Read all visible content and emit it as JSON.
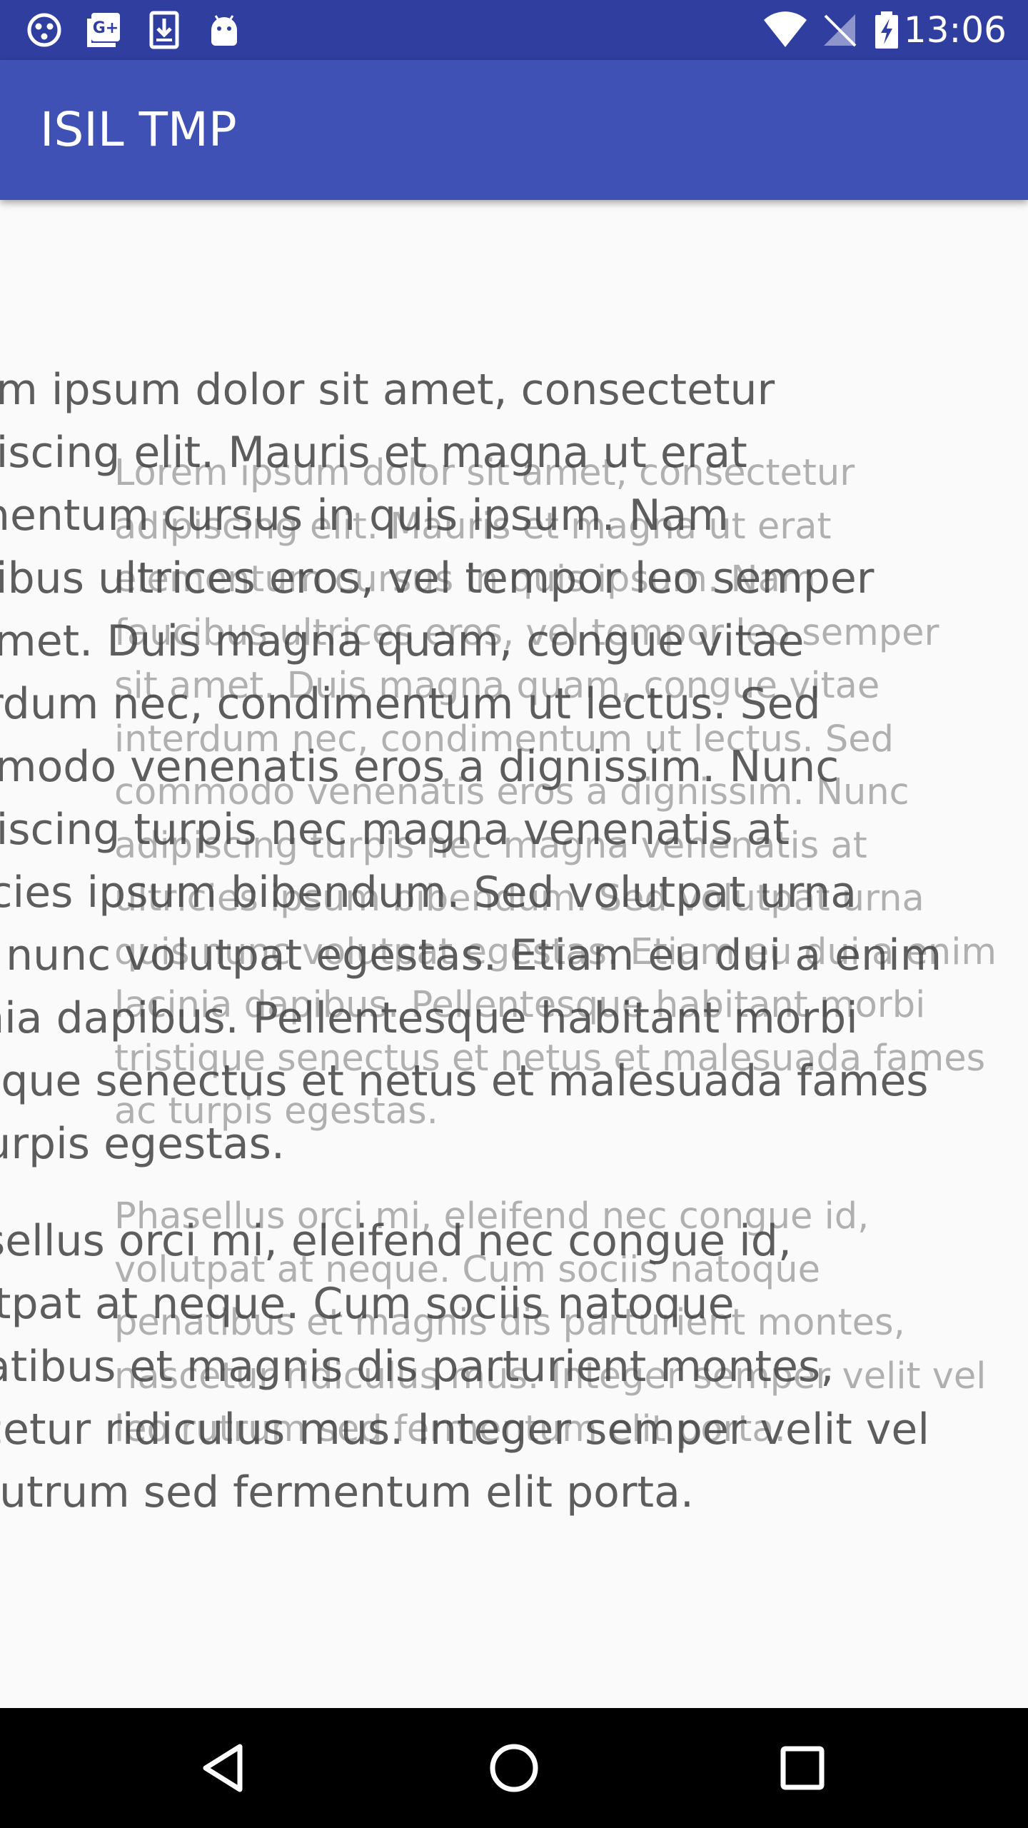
{
  "status_bar": {
    "time": "13:06",
    "left_icons": [
      "target-icon",
      "google-plus-icon",
      "download-icon",
      "android-icon"
    ],
    "right_icons": [
      "wifi-icon",
      "no-signal-icon",
      "battery-charging-icon"
    ],
    "background": "#303F9F"
  },
  "app_bar": {
    "title": "ISIL TMP",
    "background": "#3F51B5"
  },
  "paragraphs": [
    {
      "lines": [
        "Lorem ipsum dolor sit amet, consectetur",
        "adipiscing elit. Mauris et magna ut erat",
        "elementum cursus in quis ipsum. Nam",
        "faucibus ultrices eros, vel tempor leo semper",
        "sit amet. Duis magna quam, congue vitae",
        "interdum nec, condimentum ut lectus. Sed",
        "commodo venenatis eros a dignissim. Nunc",
        "adipiscing turpis nec magna venenatis at",
        "ultricies ipsum bibendum. Sed volutpat urna",
        "quis nunc volutpat egestas. Etiam eu dui a enim",
        "lacinia dapibus. Pellentesque habitant morbi",
        "tristique senectus et netus et malesuada fames",
        "ac turpis egestas."
      ]
    },
    {
      "lines": [
        "Phasellus orci mi, eleifend nec congue id,",
        "volutpat at neque. Cum sociis natoque",
        "penatibus et magnis dis parturient montes,",
        "nascetur ridiculus mus. Integer semper velit vel",
        "leo rutrum sed fermentum elit porta."
      ]
    }
  ],
  "nav_bar": {
    "buttons": [
      "back-icon",
      "home-icon",
      "recents-icon"
    ]
  }
}
